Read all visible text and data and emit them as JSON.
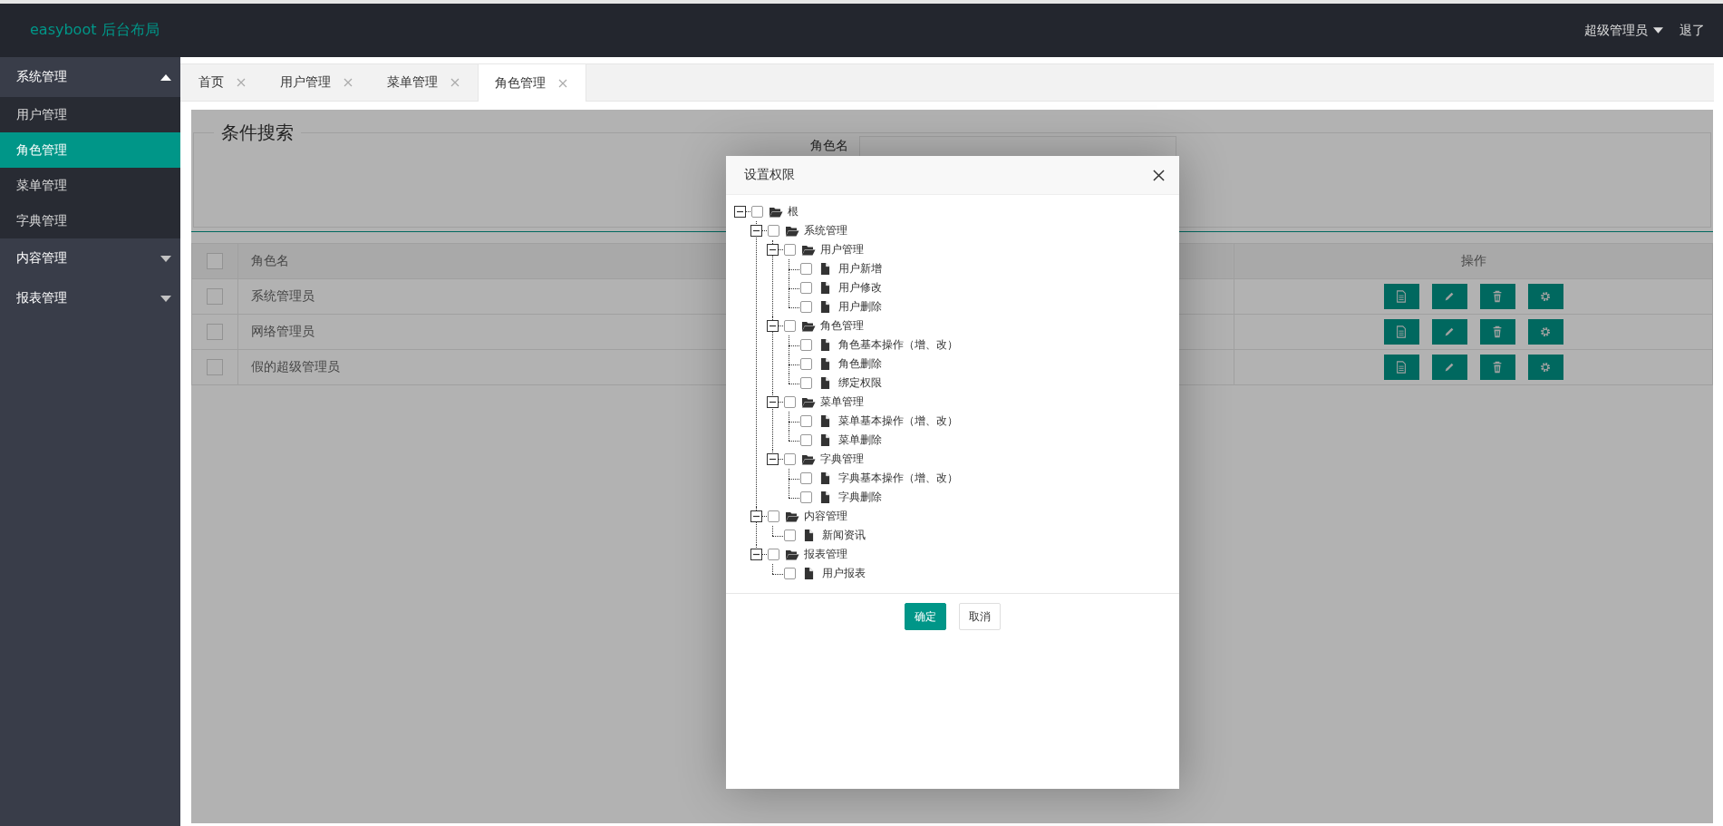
{
  "header": {
    "logo": "easyboot 后台布局",
    "user": "超级管理员",
    "logout": "退了"
  },
  "sidebar": {
    "items": [
      {
        "label": "系统管理",
        "expanded": true,
        "children": [
          {
            "label": "用户管理",
            "selected": false
          },
          {
            "label": "角色管理",
            "selected": true
          },
          {
            "label": "菜单管理",
            "selected": false
          },
          {
            "label": "字典管理",
            "selected": false
          }
        ]
      },
      {
        "label": "内容管理",
        "expanded": false
      },
      {
        "label": "报表管理",
        "expanded": false
      }
    ]
  },
  "tabs": [
    {
      "label": "首页",
      "selected": false
    },
    {
      "label": "用户管理",
      "selected": false
    },
    {
      "label": "菜单管理",
      "selected": false
    },
    {
      "label": "角色管理",
      "selected": true
    }
  ],
  "search": {
    "legend": "条件搜索",
    "field_label": "角色名"
  },
  "table": {
    "header_checked": false,
    "columns": [
      "角色名",
      "操作"
    ],
    "rows": [
      {
        "name": "系统管理员",
        "checked": false
      },
      {
        "name": "网络管理员",
        "checked": false
      },
      {
        "name": "假的超级管理员",
        "checked": false
      }
    ]
  },
  "dialog": {
    "title": "设置权限",
    "tree": [
      {
        "label": "根",
        "checked": false,
        "expanded": true,
        "children": [
          {
            "label": "系统管理",
            "checked": false,
            "expanded": true,
            "children": [
              {
                "label": "用户管理",
                "checked": false,
                "expanded": true,
                "children": [
                  {
                    "label": "用户新增",
                    "checked": false
                  },
                  {
                    "label": "用户修改",
                    "checked": false
                  },
                  {
                    "label": "用户删除",
                    "checked": false
                  }
                ]
              },
              {
                "label": "角色管理",
                "checked": false,
                "expanded": true,
                "children": [
                  {
                    "label": "角色基本操作（增、改）",
                    "checked": false
                  },
                  {
                    "label": "角色删除",
                    "checked": false
                  },
                  {
                    "label": "绑定权限",
                    "checked": false
                  }
                ]
              },
              {
                "label": "菜单管理",
                "checked": false,
                "expanded": true,
                "children": [
                  {
                    "label": "菜单基本操作（增、改）",
                    "checked": false
                  },
                  {
                    "label": "菜单删除",
                    "checked": false
                  }
                ]
              },
              {
                "label": "字典管理",
                "checked": false,
                "expanded": true,
                "children": [
                  {
                    "label": "字典基本操作（增、改）",
                    "checked": false
                  },
                  {
                    "label": "字典删除",
                    "checked": false
                  }
                ]
              }
            ]
          },
          {
            "label": "内容管理",
            "checked": false,
            "expanded": true,
            "children": [
              {
                "label": "新闻资讯",
                "checked": false
              }
            ]
          },
          {
            "label": "报表管理",
            "checked": false,
            "expanded": true,
            "children": [
              {
                "label": "用户报表",
                "checked": false
              }
            ]
          }
        ]
      }
    ],
    "buttons": [
      {
        "label": "确定",
        "kind": "primary"
      },
      {
        "label": "取消",
        "kind": "default"
      }
    ]
  }
}
